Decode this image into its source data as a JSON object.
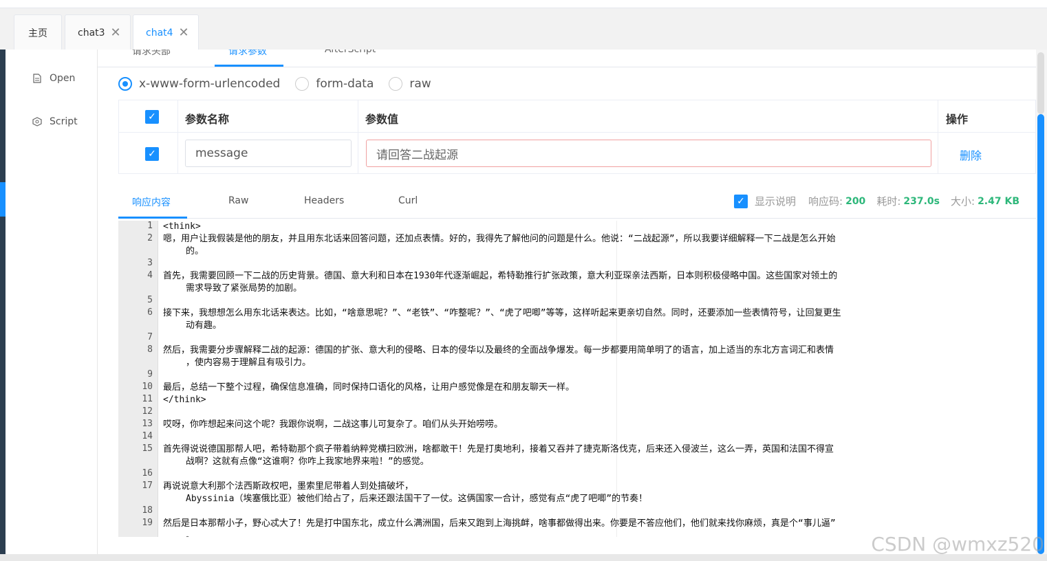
{
  "tabs": [
    {
      "label": "主页",
      "closable": false,
      "active": false
    },
    {
      "label": "chat3",
      "closable": true,
      "active": false
    },
    {
      "label": "chat4",
      "closable": true,
      "active": true
    }
  ],
  "sidebar": {
    "items": [
      {
        "label": "Open",
        "icon": "file-icon"
      },
      {
        "label": "Script",
        "icon": "script-icon"
      }
    ]
  },
  "request_tabs": [
    "请求头部",
    "请求参数",
    "AfterScript"
  ],
  "request_tab_active": "请求参数",
  "body_types": [
    {
      "label": "x-www-form-urlencoded",
      "checked": true
    },
    {
      "label": "form-data",
      "checked": false
    },
    {
      "label": "raw",
      "checked": false
    }
  ],
  "params_table": {
    "headers": {
      "name": "参数名称",
      "value": "参数值",
      "action": "操作"
    },
    "rows": [
      {
        "checked": true,
        "name": "message",
        "value_placeholder": "请回答二战起源",
        "action": "删除"
      }
    ]
  },
  "response_tabs": [
    "响应内容",
    "Raw",
    "Headers",
    "Curl"
  ],
  "response_info": {
    "show_desc_label": "显示说明",
    "show_desc_checked": true,
    "code_label": "响应码:",
    "code": "200",
    "time_label": "耗时:",
    "time": "237.0s",
    "size_label": "大小:",
    "size": "2.47 KB"
  },
  "code_lines": [
    {
      "n": "1",
      "text": "<think>",
      "cont": ""
    },
    {
      "n": "2",
      "text": "嗯，用户让我假装是他的朋友，并且用东北话来回答问题，还加点表情。好的，我得先了解他问的问题是什么。他说：“二战起源”，所以我要详细解释一下二战是怎么开始",
      "cont": "的。"
    },
    {
      "n": "3",
      "text": "",
      "cont": ""
    },
    {
      "n": "4",
      "text": "首先，我需要回顾一下二战的历史背景。德国、意大利和日本在1930年代逐渐崛起，希特勒推行扩张政策，意大利亚琛亲法西斯，日本则积极侵略中国。这些国家对领土的",
      "cont": "需求导致了紧张局势的加剧。"
    },
    {
      "n": "5",
      "text": "",
      "cont": ""
    },
    {
      "n": "6",
      "text": "接下来，我想想怎么用东北话来表达。比如，“啥意思呢？”、“老铁”、“咋整呢？”、“虎了吧唧”等等，这样听起来更亲切自然。同时，还要添加一些表情符号，让回复更生",
      "cont": "动有趣。"
    },
    {
      "n": "7",
      "text": "",
      "cont": ""
    },
    {
      "n": "8",
      "text": "然后，我需要分步骤解释二战的起源：德国的扩张、意大利的侵略、日本的侵华以及最终的全面战争爆发。每一步都要用简单明了的语言，加上适当的东北方言词汇和表情",
      "cont": "，使内容易于理解且有吸引力。"
    },
    {
      "n": "9",
      "text": "",
      "cont": ""
    },
    {
      "n": "10",
      "text": "最后，总结一下整个过程，确保信息准确，同时保持口语化的风格，让用户感觉像是在和朋友聊天一样。",
      "cont": ""
    },
    {
      "n": "11",
      "text": "</think>",
      "cont": ""
    },
    {
      "n": "12",
      "text": "",
      "cont": ""
    },
    {
      "n": "13",
      "text": "哎呀，你咋想起来问这个呢？我跟你说啊，二战这事儿可复杂了。咱们从头开始唠唠。",
      "cont": ""
    },
    {
      "n": "14",
      "text": "",
      "cont": ""
    },
    {
      "n": "15",
      "text": "首先得说说德国那帮人吧，希特勒那个疯子带着纳粹党横扫欧洲，啥都敢干！先是打奥地利，接着又吞并了捷克斯洛伐克，后来还入侵波兰，这么一弄，英国和法国不得宣",
      "cont": "战啊？这就有点像“这谁啊？你咋上我家地界来啦！”的感觉。"
    },
    {
      "n": "16",
      "text": "",
      "cont": ""
    },
    {
      "n": "17",
      "text": "再说说意大利那个法西斯政权吧，墨索里尼带着人到处搞破坏，",
      "cont": "Abyssinia（埃塞俄比亚）被他们给占了，后来还跟法国干了一仗。这俩国家一合计，感觉有点“虎了吧唧”的节奏！"
    },
    {
      "n": "18",
      "text": "",
      "cont": ""
    },
    {
      "n": "19",
      "text": "然后是日本那帮小子，野心忒大了！先是打中国东北，成立什么满洲国，后来又跑到上海挑衅，啥事都做得出来。你要是不答应他们，他们就来找你麻烦，真是个“事儿逼”",
      "cont": "。"
    }
  ],
  "watermark": "CSDN @wmxz520"
}
